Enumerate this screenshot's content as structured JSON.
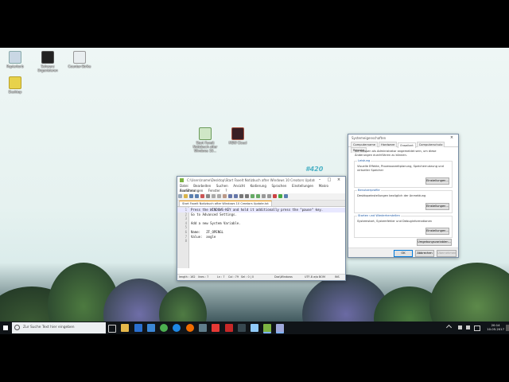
{
  "desktop": {
    "icons": [
      {
        "label": "Papierkorb"
      },
      {
        "label": "Schwarz Organisieren"
      },
      {
        "label": "Counter-Strike"
      },
      {
        "label": "Desktop"
      },
      {
        "label": "Start Faxelt Notizbuch after Windows 10..."
      },
      {
        "label": "MSW Cloud"
      }
    ],
    "watermark": "#420"
  },
  "notepad": {
    "title": "C:\\Users\\name\\Desktop\\Start Faxelt Notizbuch after Windows 10 Creators Update.txt - N...",
    "menu": [
      "Datei",
      "Bearbeiten",
      "Suchen",
      "Ansicht",
      "Kodierung",
      "Sprachen",
      "Einstellungen",
      "Makro",
      "Ausführen"
    ],
    "menu2": [
      "Erweiterungen",
      "Fenster",
      "?"
    ],
    "tab_label": "Start Faxelt Notizbuch after Windows 10 Creators Update.txt",
    "lines": [
      {
        "n": "1",
        "text": "Press the WINDOWS-KEY and hold it additionally press the \"pause\" key."
      },
      {
        "n": "2",
        "text": "Go to Advanced Settings."
      },
      {
        "n": "3",
        "text": ""
      },
      {
        "n": "4",
        "text": "Add a new System Variable."
      },
      {
        "n": "5",
        "text": ""
      },
      {
        "n": "6",
        "text": "Name:   ZF_OPENGL"
      },
      {
        "n": "7",
        "text": "Value:  angle"
      },
      {
        "n": "8",
        "text": ""
      }
    ],
    "status": {
      "length": "length : 162",
      "lines": "lines : 7",
      "pos": "Ln : 7",
      "col": "Col : 79",
      "sel": "Sel : 0 | 0",
      "eol": "Dos\\Windows",
      "enc": "UTF-8 w/o BOM",
      "mode": "INS"
    }
  },
  "sysprops": {
    "title": "Systemeigenschaften",
    "tabs": [
      "Computername",
      "Hardware",
      "Erweitert",
      "Computerschutz",
      "Remote"
    ],
    "active_tab": "Erweitert",
    "admin_note": "Sie müssen als Administrator angemeldet sein, um diese Änderungen durchführen zu können.",
    "perf_title": "Leistung",
    "perf_text": "Visuelle Effekte, Prozessorzeitplanung, Speichernutzung und virtueller Speicher",
    "profiles_title": "Benutzerprofile",
    "profiles_text": "Desktopeinstellungen bezüglich der Anmeldung",
    "startup_title": "Starten und Wiederherstellen",
    "startup_text": "Systemstart, Systemfehler und Debuginformationen",
    "settings_btn": "Einstellungen...",
    "env_btn": "Umgebungsvariablen...",
    "ok": "OK",
    "cancel": "Abbrechen",
    "apply": "Übernehmen"
  },
  "taskbar": {
    "search_placeholder": "Zur Suche Text hier eingeben",
    "time": "20:14",
    "date": "10.05.2017"
  }
}
